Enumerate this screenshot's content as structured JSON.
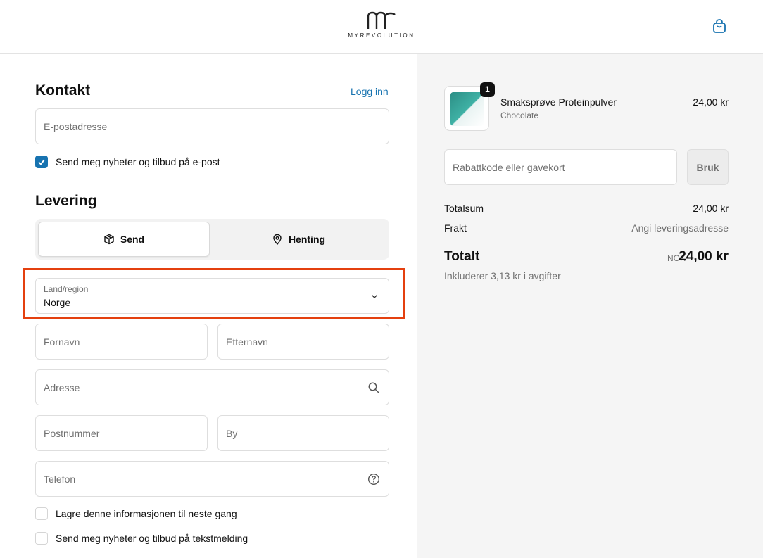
{
  "header": {
    "brand": "MYREVOLUTION",
    "cart_icon": "shopping-bag-icon"
  },
  "contact": {
    "title": "Kontakt",
    "login_link": "Logg inn",
    "email_placeholder": "E-postadresse",
    "newsletter_label": "Send meg nyheter og tilbud på e-post",
    "newsletter_checked": true
  },
  "delivery": {
    "title": "Levering",
    "options": [
      {
        "label": "Send",
        "icon": "package-icon",
        "selected": true
      },
      {
        "label": "Henting",
        "icon": "map-pin-icon",
        "selected": false
      }
    ],
    "country": {
      "label": "Land/region",
      "value": "Norge"
    },
    "first_name_placeholder": "Fornavn",
    "last_name_placeholder": "Etternavn",
    "address_placeholder": "Adresse",
    "postcode_placeholder": "Postnummer",
    "city_placeholder": "By",
    "phone_placeholder": "Telefon",
    "save_info_label": "Lagre denne informasjonen til neste gang",
    "sms_label": "Send meg nyheter og tilbud på tekstmelding"
  },
  "summary": {
    "items": [
      {
        "quantity": "1",
        "name": "Smaksprøve Proteinpulver",
        "variant": "Chocolate",
        "price": "24,00 kr"
      }
    ],
    "discount_placeholder": "Rabattkode eller gavekort",
    "apply_label": "Bruk",
    "subtotal_label": "Totalsum",
    "subtotal_value": "24,00 kr",
    "shipping_label": "Frakt",
    "shipping_value": "Angi leveringsadresse",
    "total_label": "Totalt",
    "currency": "NOK",
    "total_value": "24,00 kr",
    "tax_note": "Inkluderer 3,13 kr i avgifter"
  },
  "colors": {
    "accent": "#1773b0",
    "highlight": "#e4400f"
  }
}
